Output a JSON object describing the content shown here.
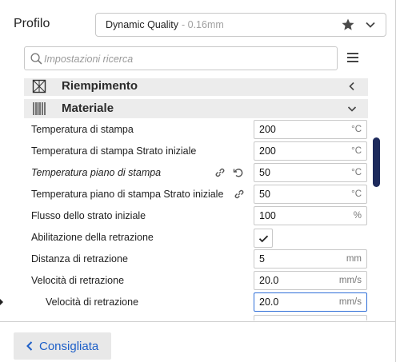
{
  "header": {
    "profile_label": "Profilo",
    "profile_name": "Dynamic Quality",
    "profile_layer": "- 0.16mm"
  },
  "search": {
    "placeholder": "Impostazioni ricerca"
  },
  "categories": [
    {
      "label": "Riempimento",
      "state": "collapsed",
      "icon": "infill-icon"
    },
    {
      "label": "Materiale",
      "state": "expanded",
      "icon": "material-icon"
    }
  ],
  "settings": [
    {
      "label": "Temperatura di stampa",
      "value": "200",
      "unit": "°C"
    },
    {
      "label": "Temperatura di stampa Strato iniziale",
      "value": "200",
      "unit": "°C"
    },
    {
      "label": "Temperatura piano di stampa",
      "value": "50",
      "unit": "°C"
    },
    {
      "label": "Temperatura piano di stampa Strato iniziale",
      "value": "50",
      "unit": "°C"
    },
    {
      "label": "Flusso dello strato iniziale",
      "value": "100",
      "unit": "%"
    },
    {
      "label": "Abilitazione della retrazione",
      "checked": true
    },
    {
      "label": "Distanza di retrazione",
      "value": "5",
      "unit": "mm"
    },
    {
      "label": "Velocità di retrazione",
      "value": "20.0",
      "unit": "mm/s"
    },
    {
      "label": "Velocità di retrazione",
      "value": "20.0",
      "unit": "mm/s"
    }
  ],
  "footer": {
    "back_label": "Consigliata"
  },
  "colors": {
    "accent": "#1d5fc8",
    "scrollbar": "#1d2a5c",
    "active_border": "#2f6fd8"
  }
}
